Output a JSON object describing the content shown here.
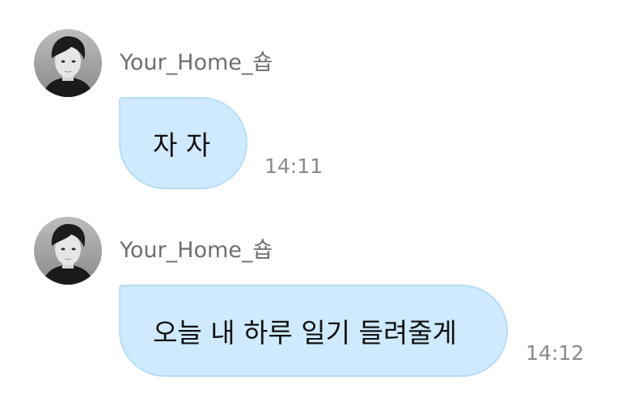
{
  "messages": [
    {
      "sender": "Your_Home_숍",
      "avatar_icon": "profile-photo-icon",
      "text": "자 자",
      "time": "14:11"
    },
    {
      "sender": "Your_Home_숍",
      "avatar_icon": "profile-photo-icon",
      "text": "오늘 내 하루 일기 들려줄게",
      "time": "14:12"
    }
  ],
  "colors": {
    "bubble": "#cfeafe",
    "bubble_border": "#b7dcf6",
    "sender_text": "#6f6f6f",
    "time_text": "#8a8a8a",
    "message_text": "#111111"
  }
}
